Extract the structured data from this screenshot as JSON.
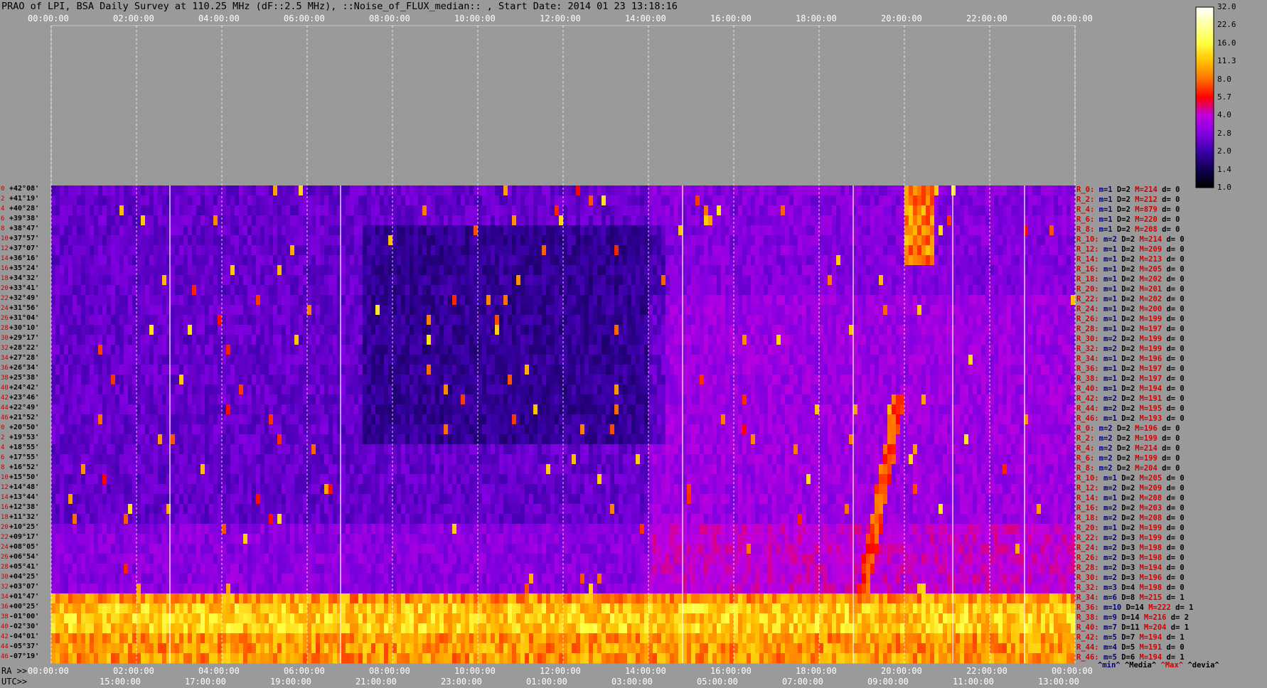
{
  "title": "PRAO of LPI, BSA Daily Survey at 110.25 MHz (dF::2.5 MHz), ::Noise_of_FLUX_median:: , Start Date: 2014 01 23 13:18:16",
  "colors": {
    "background": "#9a9a9a",
    "stat_red": "#d40000",
    "stat_blue": "#000080",
    "stat_black": "#000000"
  },
  "chart_data": {
    "type": "heatmap",
    "title": "PRAO of LPI, BSA Daily Survey at 110.25 MHz (dF::2.5 MHz), ::Noise_of_FLUX_median:: , Start Date: 2014 01 23 13:18:16",
    "x_top_ticks": [
      "00:00:00",
      "02:00:00",
      "04:00:00",
      "06:00:00",
      "08:00:00",
      "10:00:00",
      "12:00:00",
      "14:00:00",
      "16:00:00",
      "18:00:00",
      "20:00:00",
      "22:00:00",
      "00:00:00"
    ],
    "x_bottom_ra_label": "RA >>",
    "x_bottom_ra_ticks": [
      "00:00:00",
      "02:00:00",
      "04:00:00",
      "06:00:00",
      "08:00:00",
      "10:00:00",
      "12:00:00",
      "14:00:00",
      "16:00:00",
      "18:00:00",
      "20:00:00",
      "22:00:00",
      "00:00:00"
    ],
    "x_bottom_utc_label": "UTC>>",
    "x_bottom_utc_ticks": [
      "15:00:00",
      "17:00:00",
      "19:00:00",
      "21:00:00",
      "23:00:00",
      "01:00:00",
      "03:00:00",
      "05:00:00",
      "07:00:00",
      "09:00:00",
      "11:00:00",
      "13:00:00"
    ],
    "y_labels": [
      "+42°08'",
      "+41°19'",
      "+40°28'",
      "+39°38'",
      "+38°47'",
      "+37°57'",
      "+37°07'",
      "+36°16'",
      "+35°24'",
      "+34°32'",
      "+33°41'",
      "+32°49'",
      "+31°56'",
      "+31°04'",
      "+30°10'",
      "+29°17'",
      "+28°22'",
      "+27°28'",
      "+26°34'",
      "+25°38'",
      "+24°42'",
      "+23°46'",
      "+22°49'",
      "+21°52'",
      "+20°50'",
      "+19°53'",
      "+18°55'",
      "+17°55'",
      "+16°52'",
      "+15°50'",
      "+14°48'",
      "+13°44'",
      "+12°38'",
      "+11°32'",
      "+10°25'",
      "+09°17'",
      "+08°05'",
      "+06°54'",
      "+05°41'",
      "+04°25'",
      "+03°07'",
      "+01°47'",
      "+00°25'",
      "-01°00'",
      "-02°30'",
      "-04°01'",
      "-05°37'",
      "-07°19'"
    ],
    "row_index": [
      "0",
      "2",
      "4",
      "6",
      "8",
      "10",
      "12",
      "14",
      "16",
      "18",
      "20",
      "22",
      "24",
      "26",
      "28",
      "30",
      "32",
      "34",
      "36",
      "38",
      "40",
      "42",
      "44",
      "46",
      "0",
      "2",
      "4",
      "6",
      "8",
      "10",
      "12",
      "14",
      "16",
      "18",
      "20",
      "22",
      "24",
      "26",
      "28",
      "30",
      "32",
      "34",
      "36",
      "38",
      "40",
      "42",
      "44",
      "46"
    ],
    "row_stats": [
      {
        "r": "R_0:",
        "m": "m=1",
        "D": "D=2",
        "M": "M=214",
        "d": "d= 0"
      },
      {
        "r": "R_2:",
        "m": "m=1",
        "D": "D=2",
        "M": "M=212",
        "d": "d= 0"
      },
      {
        "r": "R_4:",
        "m": "m=1",
        "D": "D=2",
        "M": "M=879",
        "d": "d= 0"
      },
      {
        "r": "R_6:",
        "m": "m=1",
        "D": "D=2",
        "M": "M=220",
        "d": "d= 0"
      },
      {
        "r": "R_8:",
        "m": "m=1",
        "D": "D=2",
        "M": "M=208",
        "d": "d= 0"
      },
      {
        "r": "R_10:",
        "m": "m=2",
        "D": "D=2",
        "M": "M=214",
        "d": "d= 0"
      },
      {
        "r": "R_12:",
        "m": "m=1",
        "D": "D=2",
        "M": "M=209",
        "d": "d= 0"
      },
      {
        "r": "R_14:",
        "m": "m=1",
        "D": "D=2",
        "M": "M=213",
        "d": "d= 0"
      },
      {
        "r": "R_16:",
        "m": "m=1",
        "D": "D=2",
        "M": "M=205",
        "d": "d= 0"
      },
      {
        "r": "R_18:",
        "m": "m=1",
        "D": "D=2",
        "M": "M=202",
        "d": "d= 0"
      },
      {
        "r": "R_20:",
        "m": "m=1",
        "D": "D=2",
        "M": "M=201",
        "d": "d= 0"
      },
      {
        "r": "R_22:",
        "m": "m=1",
        "D": "D=2",
        "M": "M=202",
        "d": "d= 0"
      },
      {
        "r": "R_24:",
        "m": "m=1",
        "D": "D=2",
        "M": "M=200",
        "d": "d= 0"
      },
      {
        "r": "R_26:",
        "m": "m=1",
        "D": "D=2",
        "M": "M=199",
        "d": "d= 0"
      },
      {
        "r": "R_28:",
        "m": "m=1",
        "D": "D=2",
        "M": "M=197",
        "d": "d= 0"
      },
      {
        "r": "R_30:",
        "m": "m=2",
        "D": "D=2",
        "M": "M=199",
        "d": "d= 0"
      },
      {
        "r": "R_32:",
        "m": "m=2",
        "D": "D=2",
        "M": "M=199",
        "d": "d= 0"
      },
      {
        "r": "R_34:",
        "m": "m=1",
        "D": "D=2",
        "M": "M=196",
        "d": "d= 0"
      },
      {
        "r": "R_36:",
        "m": "m=1",
        "D": "D=2",
        "M": "M=197",
        "d": "d= 0"
      },
      {
        "r": "R_38:",
        "m": "m=1",
        "D": "D=2",
        "M": "M=197",
        "d": "d= 0"
      },
      {
        "r": "R_40:",
        "m": "m=1",
        "D": "D=2",
        "M": "M=194",
        "d": "d= 0"
      },
      {
        "r": "R_42:",
        "m": "m=2",
        "D": "D=2",
        "M": "M=191",
        "d": "d= 0"
      },
      {
        "r": "R_44:",
        "m": "m=2",
        "D": "D=2",
        "M": "M=195",
        "d": "d= 0"
      },
      {
        "r": "R_46:",
        "m": "m=1",
        "D": "D=2",
        "M": "M=193",
        "d": "d= 0"
      },
      {
        "r": "R_0:",
        "m": "m=2",
        "D": "D=2",
        "M": "M=196",
        "d": "d= 0"
      },
      {
        "r": "R_2:",
        "m": "m=2",
        "D": "D=2",
        "M": "M=199",
        "d": "d= 0"
      },
      {
        "r": "R_4:",
        "m": "m=2",
        "D": "D=2",
        "M": "M=214",
        "d": "d= 0"
      },
      {
        "r": "R_6:",
        "m": "m=2",
        "D": "D=2",
        "M": "M=199",
        "d": "d= 0"
      },
      {
        "r": "R_8:",
        "m": "m=2",
        "D": "D=2",
        "M": "M=204",
        "d": "d= 0"
      },
      {
        "r": "R_10:",
        "m": "m=1",
        "D": "D=2",
        "M": "M=205",
        "d": "d= 0"
      },
      {
        "r": "R_12:",
        "m": "m=2",
        "D": "D=2",
        "M": "M=209",
        "d": "d= 0"
      },
      {
        "r": "R_14:",
        "m": "m=1",
        "D": "D=2",
        "M": "M=208",
        "d": "d= 0"
      },
      {
        "r": "R_16:",
        "m": "m=2",
        "D": "D=2",
        "M": "M=203",
        "d": "d= 0"
      },
      {
        "r": "R_18:",
        "m": "m=2",
        "D": "D=2",
        "M": "M=208",
        "d": "d= 0"
      },
      {
        "r": "R_20:",
        "m": "m=1",
        "D": "D=2",
        "M": "M=199",
        "d": "d= 0"
      },
      {
        "r": "R_22:",
        "m": "m=2",
        "D": "D=3",
        "M": "M=199",
        "d": "d= 0"
      },
      {
        "r": "R_24:",
        "m": "m=2",
        "D": "D=3",
        "M": "M=198",
        "d": "d= 0"
      },
      {
        "r": "R_26:",
        "m": "m=2",
        "D": "D=3",
        "M": "M=198",
        "d": "d= 0"
      },
      {
        "r": "R_28:",
        "m": "m=2",
        "D": "D=3",
        "M": "M=194",
        "d": "d= 0"
      },
      {
        "r": "R_30:",
        "m": "m=2",
        "D": "D=3",
        "M": "M=196",
        "d": "d= 0"
      },
      {
        "r": "R_32:",
        "m": "m=3",
        "D": "D=4",
        "M": "M=198",
        "d": "d= 0"
      },
      {
        "r": "R_34:",
        "m": "m=6",
        "D": "D=8",
        "M": "M=215",
        "d": "d= 1"
      },
      {
        "r": "R_36:",
        "m": "m=10",
        "D": "D=14",
        "M": "M=222",
        "d": "d= 1"
      },
      {
        "r": "R_38:",
        "m": "m=9",
        "D": "D=14",
        "M": "M=216",
        "d": "d= 2"
      },
      {
        "r": "R_40:",
        "m": "m=7",
        "D": "D=11",
        "M": "M=204",
        "d": "d= 1"
      },
      {
        "r": "R_42:",
        "m": "m=5",
        "D": "D=7",
        "M": "M=194",
        "d": "d= 1"
      },
      {
        "r": "R_44:",
        "m": "m=4",
        "D": "D=5",
        "M": "M=191",
        "d": "d= 0"
      },
      {
        "r": "R_46:",
        "m": "m=5",
        "D": "D=6",
        "M": "M=194",
        "d": "d= 1"
      }
    ],
    "stats_legend": [
      "^min^",
      "^Media^",
      "^Max^",
      "^devia^"
    ],
    "colorbar_ticks": [
      "32.0",
      "22.6",
      "16.0",
      "11.3",
      "8.0",
      "5.7",
      "4.0",
      "2.8",
      "2.0",
      "1.4",
      "1.0"
    ],
    "colorbar_range": [
      1.0,
      32.0
    ],
    "colorbar_scale": "log",
    "colormap": [
      "#000000",
      "#100050",
      "#3a00a8",
      "#8000e0",
      "#c000e0",
      "#ff0000",
      "#ff7000",
      "#ffc000",
      "#ffff40",
      "#ffffff"
    ]
  }
}
